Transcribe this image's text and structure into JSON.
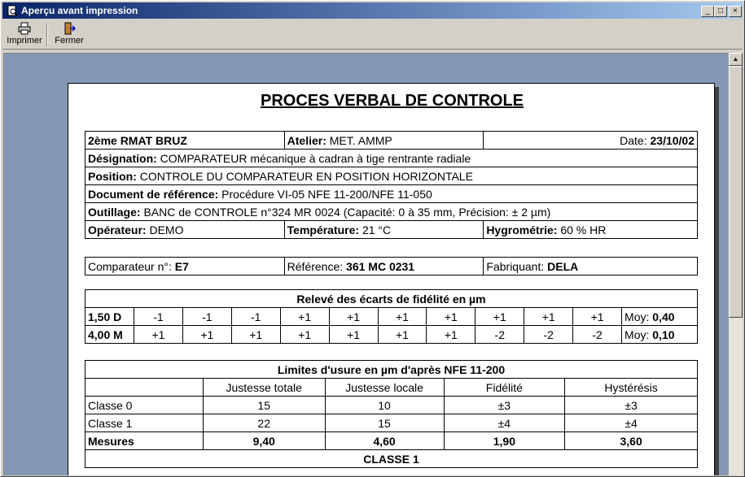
{
  "window": {
    "title": "Aperçu avant impression",
    "min_glyph": "_",
    "max_glyph": "□",
    "close_glyph": "×"
  },
  "toolbar": {
    "print_label": "Imprimer",
    "close_label": "Fermer"
  },
  "document": {
    "title": "PROCES VERBAL DE CONTROLE",
    "header": {
      "unit": "2ème RMAT BRUZ",
      "atelier_label": "Atelier:",
      "atelier_value": " MET. AMMP",
      "date_label": "Date:",
      "date_value": "23/10/02",
      "designation_label": "Désignation:",
      "designation_value": " COMPARATEUR mécanique à cadran à tige rentrante radiale",
      "position_label": "Position:",
      "position_value": " CONTROLE DU COMPARATEUR EN POSITION HORIZONTALE",
      "docref_label": "Document de référence:",
      "docref_value": " Procédure VI-05 NFE 11-200/NFE 11-050",
      "outillage_label": "Outillage:",
      "outillage_value": " BANC de CONTROLE n°324 MR 0024 (Capacité: 0 à 35 mm, Précision: ± 2 µm)",
      "operateur_label": "Opérateur:",
      "operateur_value": " DEMO",
      "temperature_label": "Température:",
      "temperature_value": " 21 °C",
      "hygrometrie_label": "Hygrométrie:",
      "hygrometrie_value": " 60 % HR"
    },
    "instrument": {
      "comparateur_label": "Comparateur n°:",
      "comparateur_value": "E7",
      "reference_label": "Référence:",
      "reference_value": "361 MC 0231",
      "fabriquant_label": "Fabriquant:",
      "fabriquant_value": "DELA"
    },
    "releve": {
      "title": "Relevé des écarts de fidélité en µm",
      "moy_label": "Moy:",
      "rows": [
        {
          "label": "1,50 D",
          "values": [
            "-1",
            "-1",
            "-1",
            "+1",
            "+1",
            "+1",
            "+1",
            "+1",
            "+1",
            "+1"
          ],
          "moy": "0,40"
        },
        {
          "label": "4,00 M",
          "values": [
            "+1",
            "+1",
            "+1",
            "+1",
            "+1",
            "+1",
            "+1",
            "-2",
            "-2",
            "-2"
          ],
          "moy": "0,10"
        }
      ]
    },
    "limites": {
      "title": "Limites d'usure en µm d'après NFE 11-200",
      "columns": [
        "Justesse totale",
        "Justesse locale",
        "Fidélité",
        "Hystérésis"
      ],
      "rows": [
        {
          "label": "Classe 0",
          "values": [
            "15",
            "10",
            "±3",
            "±3"
          ]
        },
        {
          "label": "Classe 1",
          "values": [
            "22",
            "15",
            "±4",
            "±4"
          ]
        }
      ],
      "mesures_label": "Mesures",
      "mesures": [
        "9,40",
        "4,60",
        "1,90",
        "3,60"
      ],
      "classe_result": "CLASSE 1"
    }
  }
}
